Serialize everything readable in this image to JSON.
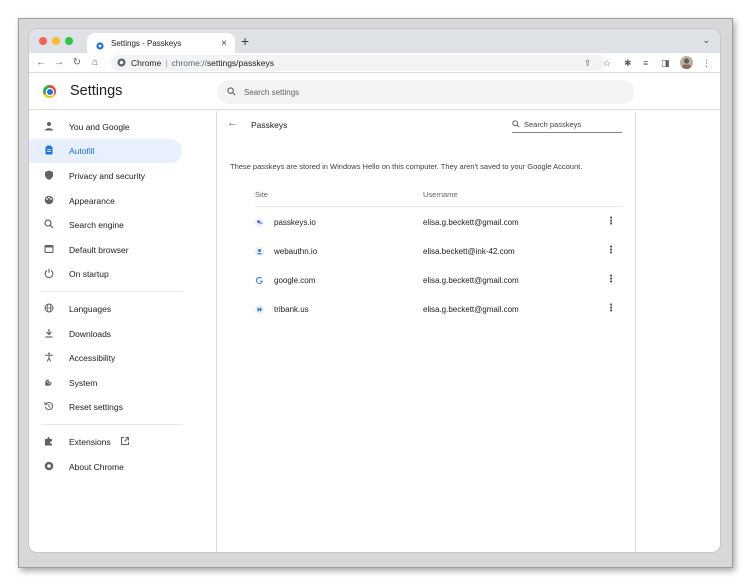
{
  "browser": {
    "tab_title": "Settings - Passkeys",
    "new_tab_label": "+",
    "tab_close_label": "×",
    "url_origin_label": "Chrome",
    "url_scheme": "chrome://",
    "url_path": "settings/passkeys"
  },
  "header": {
    "title": "Settings",
    "search_placeholder": "Search settings"
  },
  "sidebar": {
    "items": [
      {
        "label": "You and Google",
        "icon": "person-icon"
      },
      {
        "label": "Autofill",
        "icon": "clipboard-icon",
        "active": true
      },
      {
        "label": "Privacy and security",
        "icon": "shield-icon"
      },
      {
        "label": "Appearance",
        "icon": "palette-icon"
      },
      {
        "label": "Search engine",
        "icon": "search-icon"
      },
      {
        "label": "Default browser",
        "icon": "browser-icon"
      },
      {
        "label": "On startup",
        "icon": "power-icon"
      },
      {
        "label": "Languages",
        "icon": "globe-icon"
      },
      {
        "label": "Downloads",
        "icon": "download-icon"
      },
      {
        "label": "Accessibility",
        "icon": "accessibility-icon"
      },
      {
        "label": "System",
        "icon": "wrench-icon"
      },
      {
        "label": "Reset settings",
        "icon": "reset-icon"
      },
      {
        "label": "Extensions",
        "icon": "puzzle-icon"
      },
      {
        "label": "About Chrome",
        "icon": "chrome-icon"
      }
    ]
  },
  "passkeys": {
    "title": "Passkeys",
    "search_placeholder": "Search passkeys",
    "description": "These passkeys are stored in Windows Hello on this computer. They aren't saved to your Google Account.",
    "columns": {
      "site": "Site",
      "username": "Username"
    },
    "rows": [
      {
        "site": "passkeys.io",
        "username": "elisa.g.beckett@gmail.com"
      },
      {
        "site": "webauthn.io",
        "username": "elisa.beckett@ink-42.com"
      },
      {
        "site": "google.com",
        "username": "elisa.g.beckett@gmail.com"
      },
      {
        "site": "tribank.us",
        "username": "elisa.g.beckett@gmail.com"
      }
    ]
  },
  "colors": {
    "accent": "#1a73e8",
    "active_bg": "#e8f0fe",
    "tabstrip_bg": "#dee1e6"
  }
}
